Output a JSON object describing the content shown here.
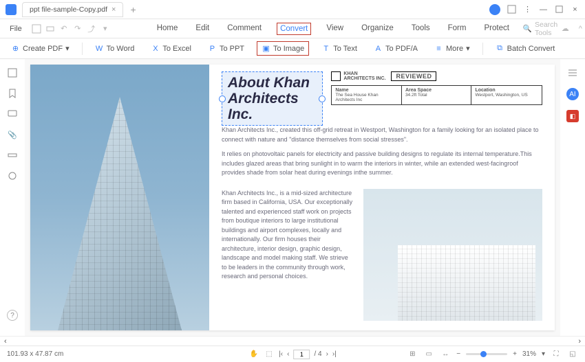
{
  "tab": {
    "title": "ppt file-sample-Copy.pdf"
  },
  "file_menu": "File",
  "menu": [
    "Home",
    "Edit",
    "Comment",
    "Convert",
    "View",
    "Organize",
    "Tools",
    "Form",
    "Protect"
  ],
  "menu_selected": "Convert",
  "search_placeholder": "Search Tools",
  "toolbar": {
    "create_pdf": "Create PDF",
    "to_word": "To Word",
    "to_excel": "To Excel",
    "to_ppt": "To PPT",
    "to_image": "To Image",
    "to_text": "To Text",
    "to_pdfa": "To PDF/A",
    "more": "More",
    "batch": "Batch Convert"
  },
  "doc": {
    "title_l1": "About Khan",
    "title_l2": "Architects Inc.",
    "khan_label1": "KHAN",
    "khan_label2": "ARCHITECTS INC.",
    "reviewed": "REVIEWED",
    "info": {
      "name_h": "Name",
      "name_v": "The Sea House Khan Architects Inc",
      "area_h": "Area Space",
      "area_v": "34.2ft Total",
      "loc_h": "Location",
      "loc_v": "Westport, Washington, US"
    },
    "p1": "Khan Architects Inc., created this off-grid retreat in Westport, Washington for a family looking for an isolated place to connect with nature and \"distance themselves from social stresses\".",
    "p2": "It relies on photovoltaic panels for electricity and passive building designs to regulate its internal temperature.This includes glazed areas that bring sunlight in to warm the interiors in winter, while an extended west-facingroof provides shade from solar heat during evenings inthe summer.",
    "p3": "Khan Architects Inc., is a mid-sized architecture firm based in California, USA. Our exceptionally talented and experienced staff work on projects from boutique interiors to large institutional buildings and airport complexes, locally and internationally. Our firm houses their architecture, interior design, graphic design, landscape and model making staff. We strieve to be leaders in the community through work, research and personal choices."
  },
  "status": {
    "dims": "101.93 x 47.87 cm",
    "page": "1",
    "pages": "/ 4",
    "zoom": "31%"
  }
}
